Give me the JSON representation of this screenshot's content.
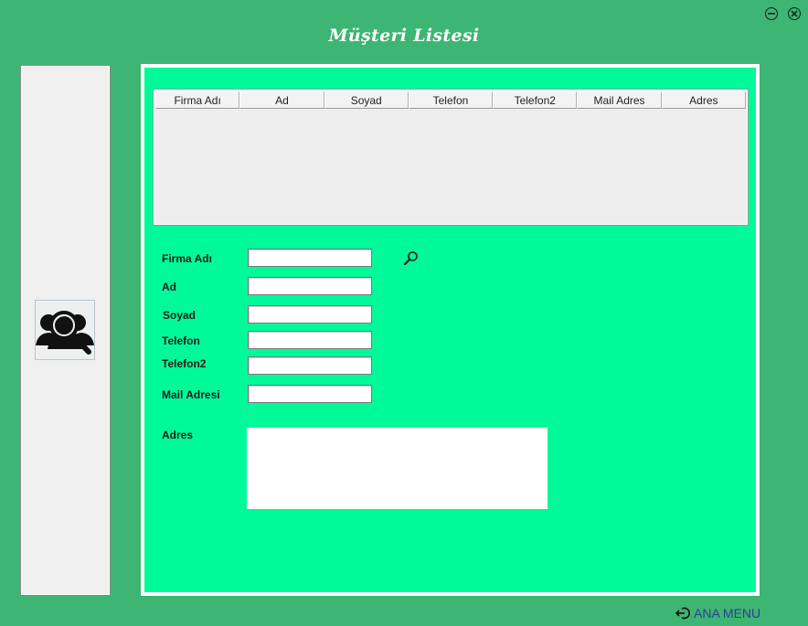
{
  "window": {
    "title": "Müşteri Listesi"
  },
  "table": {
    "columns": [
      "Firma Adı",
      "Ad",
      "Soyad",
      "Telefon",
      "Telefon2",
      "Mail Adres",
      "Adres"
    ],
    "rows": []
  },
  "form": {
    "firma_adi_label": "Firma Adı",
    "ad_label": "Ad",
    "soyad_label": "Soyad",
    "telefon_label": "Telefon",
    "telefon2_label": "Telefon2",
    "mail_label": "Mail Adresi",
    "adres_label": "Adres",
    "firma_adi_value": "",
    "ad_value": "",
    "soyad_value": "",
    "telefon_value": "",
    "telefon2_value": "",
    "mail_value": "",
    "adres_value": ""
  },
  "footer": {
    "ana_menu_label": "ANA MENU"
  },
  "icons": {
    "minimize": "minimize-icon",
    "close": "close-icon",
    "customers": "customer-search-icon",
    "search": "search-icon",
    "back": "exit-arrow-icon"
  },
  "colors": {
    "background": "#3db573",
    "panel": "#00fa9a",
    "link": "#2a3f8f"
  }
}
